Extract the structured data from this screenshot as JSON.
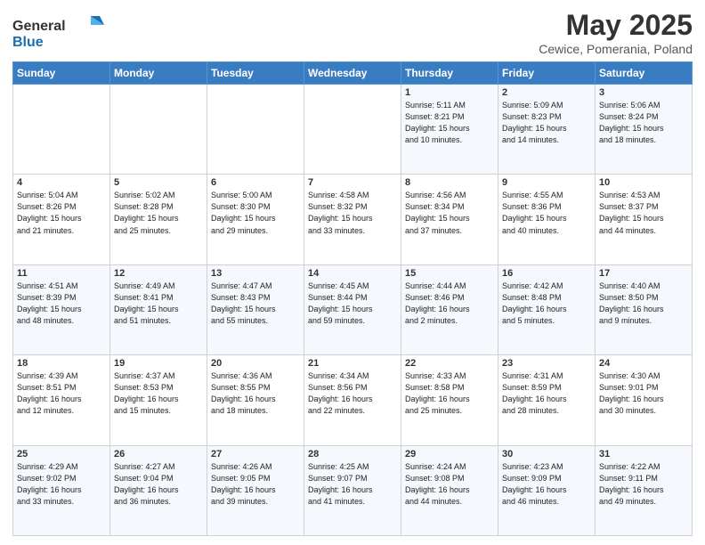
{
  "logo": {
    "general": "General",
    "blue": "Blue"
  },
  "title": "May 2025",
  "subtitle": "Cewice, Pomerania, Poland",
  "weekdays": [
    "Sunday",
    "Monday",
    "Tuesday",
    "Wednesday",
    "Thursday",
    "Friday",
    "Saturday"
  ],
  "weeks": [
    [
      {
        "day": "",
        "info": ""
      },
      {
        "day": "",
        "info": ""
      },
      {
        "day": "",
        "info": ""
      },
      {
        "day": "",
        "info": ""
      },
      {
        "day": "1",
        "info": "Sunrise: 5:11 AM\nSunset: 8:21 PM\nDaylight: 15 hours\nand 10 minutes."
      },
      {
        "day": "2",
        "info": "Sunrise: 5:09 AM\nSunset: 8:23 PM\nDaylight: 15 hours\nand 14 minutes."
      },
      {
        "day": "3",
        "info": "Sunrise: 5:06 AM\nSunset: 8:24 PM\nDaylight: 15 hours\nand 18 minutes."
      }
    ],
    [
      {
        "day": "4",
        "info": "Sunrise: 5:04 AM\nSunset: 8:26 PM\nDaylight: 15 hours\nand 21 minutes."
      },
      {
        "day": "5",
        "info": "Sunrise: 5:02 AM\nSunset: 8:28 PM\nDaylight: 15 hours\nand 25 minutes."
      },
      {
        "day": "6",
        "info": "Sunrise: 5:00 AM\nSunset: 8:30 PM\nDaylight: 15 hours\nand 29 minutes."
      },
      {
        "day": "7",
        "info": "Sunrise: 4:58 AM\nSunset: 8:32 PM\nDaylight: 15 hours\nand 33 minutes."
      },
      {
        "day": "8",
        "info": "Sunrise: 4:56 AM\nSunset: 8:34 PM\nDaylight: 15 hours\nand 37 minutes."
      },
      {
        "day": "9",
        "info": "Sunrise: 4:55 AM\nSunset: 8:36 PM\nDaylight: 15 hours\nand 40 minutes."
      },
      {
        "day": "10",
        "info": "Sunrise: 4:53 AM\nSunset: 8:37 PM\nDaylight: 15 hours\nand 44 minutes."
      }
    ],
    [
      {
        "day": "11",
        "info": "Sunrise: 4:51 AM\nSunset: 8:39 PM\nDaylight: 15 hours\nand 48 minutes."
      },
      {
        "day": "12",
        "info": "Sunrise: 4:49 AM\nSunset: 8:41 PM\nDaylight: 15 hours\nand 51 minutes."
      },
      {
        "day": "13",
        "info": "Sunrise: 4:47 AM\nSunset: 8:43 PM\nDaylight: 15 hours\nand 55 minutes."
      },
      {
        "day": "14",
        "info": "Sunrise: 4:45 AM\nSunset: 8:44 PM\nDaylight: 15 hours\nand 59 minutes."
      },
      {
        "day": "15",
        "info": "Sunrise: 4:44 AM\nSunset: 8:46 PM\nDaylight: 16 hours\nand 2 minutes."
      },
      {
        "day": "16",
        "info": "Sunrise: 4:42 AM\nSunset: 8:48 PM\nDaylight: 16 hours\nand 5 minutes."
      },
      {
        "day": "17",
        "info": "Sunrise: 4:40 AM\nSunset: 8:50 PM\nDaylight: 16 hours\nand 9 minutes."
      }
    ],
    [
      {
        "day": "18",
        "info": "Sunrise: 4:39 AM\nSunset: 8:51 PM\nDaylight: 16 hours\nand 12 minutes."
      },
      {
        "day": "19",
        "info": "Sunrise: 4:37 AM\nSunset: 8:53 PM\nDaylight: 16 hours\nand 15 minutes."
      },
      {
        "day": "20",
        "info": "Sunrise: 4:36 AM\nSunset: 8:55 PM\nDaylight: 16 hours\nand 18 minutes."
      },
      {
        "day": "21",
        "info": "Sunrise: 4:34 AM\nSunset: 8:56 PM\nDaylight: 16 hours\nand 22 minutes."
      },
      {
        "day": "22",
        "info": "Sunrise: 4:33 AM\nSunset: 8:58 PM\nDaylight: 16 hours\nand 25 minutes."
      },
      {
        "day": "23",
        "info": "Sunrise: 4:31 AM\nSunset: 8:59 PM\nDaylight: 16 hours\nand 28 minutes."
      },
      {
        "day": "24",
        "info": "Sunrise: 4:30 AM\nSunset: 9:01 PM\nDaylight: 16 hours\nand 30 minutes."
      }
    ],
    [
      {
        "day": "25",
        "info": "Sunrise: 4:29 AM\nSunset: 9:02 PM\nDaylight: 16 hours\nand 33 minutes."
      },
      {
        "day": "26",
        "info": "Sunrise: 4:27 AM\nSunset: 9:04 PM\nDaylight: 16 hours\nand 36 minutes."
      },
      {
        "day": "27",
        "info": "Sunrise: 4:26 AM\nSunset: 9:05 PM\nDaylight: 16 hours\nand 39 minutes."
      },
      {
        "day": "28",
        "info": "Sunrise: 4:25 AM\nSunset: 9:07 PM\nDaylight: 16 hours\nand 41 minutes."
      },
      {
        "day": "29",
        "info": "Sunrise: 4:24 AM\nSunset: 9:08 PM\nDaylight: 16 hours\nand 44 minutes."
      },
      {
        "day": "30",
        "info": "Sunrise: 4:23 AM\nSunset: 9:09 PM\nDaylight: 16 hours\nand 46 minutes."
      },
      {
        "day": "31",
        "info": "Sunrise: 4:22 AM\nSunset: 9:11 PM\nDaylight: 16 hours\nand 49 minutes."
      }
    ]
  ]
}
